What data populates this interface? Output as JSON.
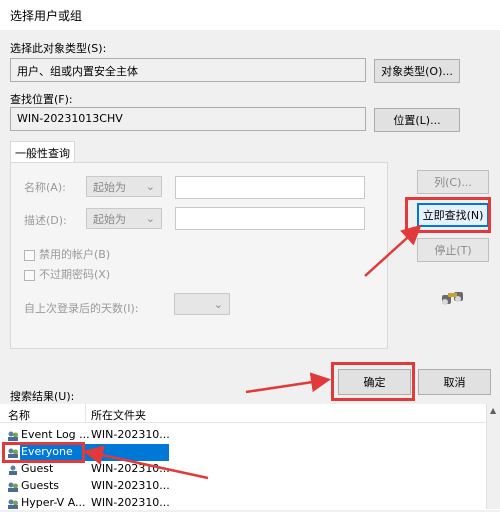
{
  "dialog": {
    "title": "选择用户或组"
  },
  "object_type": {
    "label": "选择此对象类型(S):",
    "value": "用户、组或内置安全主体",
    "button": "对象类型(O)..."
  },
  "location": {
    "label": "查找位置(F):",
    "value": "WIN-20231013CHV",
    "button": "位置(L)..."
  },
  "query": {
    "tab": "一般性查询",
    "name_label": "名称(A):",
    "name_combo": "起始为",
    "desc_label": "描述(D):",
    "desc_combo": "起始为",
    "disabled_accounts": "禁用的帐户(B)",
    "non_expiring": "不过期密码(X)",
    "days_label": "自上次登录后的天数(I):"
  },
  "side_buttons": {
    "columns": "列(C)...",
    "find_now": "立即查找(N)",
    "stop": "停止(T)"
  },
  "actions": {
    "ok": "确定",
    "cancel": "取消"
  },
  "results": {
    "label": "搜索结果(U):",
    "headers": {
      "name": "名称",
      "folder": "所在文件夹"
    },
    "rows": [
      {
        "name": "Event Log ...",
        "folder": "WIN-202310..."
      },
      {
        "name": "Everyone",
        "folder": ""
      },
      {
        "name": "Guest",
        "folder": "WIN-202310..."
      },
      {
        "name": "Guests",
        "folder": "WIN-202310..."
      },
      {
        "name": "Hyper-V A...",
        "folder": "WIN-202310..."
      }
    ]
  },
  "icons": {
    "search_icon": "binoculars-icon",
    "user_icon": "user-group-icon"
  },
  "colors": {
    "selection": "#0078d7",
    "annotation": "#e23a3a"
  }
}
